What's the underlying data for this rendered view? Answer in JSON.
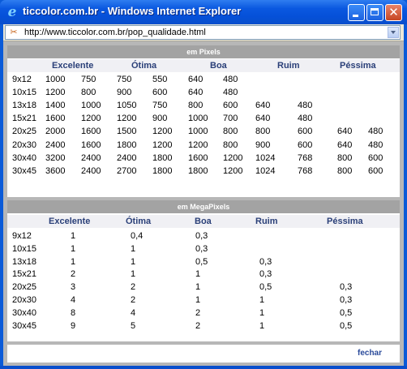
{
  "window": {
    "title": "ticcolor.com.br - Windows Internet Explorer",
    "url": "http://www.ticcolor.com.br/pop_qualidade.html"
  },
  "colors": {
    "titlebar": "#0a58e0",
    "section_bar": "#a3a3a3",
    "header_text": "#2a3f78",
    "link": "#2a4a9a"
  },
  "pixels": {
    "title": "em Pixels",
    "headers": [
      "Excelente",
      "Ótima",
      "Boa",
      "Ruim",
      "Péssima"
    ],
    "rows": [
      [
        "9x12",
        "1000",
        "750",
        "750",
        "550",
        "640",
        "480",
        "",
        "",
        "",
        ""
      ],
      [
        "10x15",
        "1200",
        "800",
        "900",
        "600",
        "640",
        "480",
        "",
        "",
        "",
        ""
      ],
      [
        "13x18",
        "1400",
        "1000",
        "1050",
        "750",
        "800",
        "600",
        "640",
        "480",
        "",
        ""
      ],
      [
        "15x21",
        "1600",
        "1200",
        "1200",
        "900",
        "1000",
        "700",
        "640",
        "480",
        "",
        ""
      ],
      [
        "20x25",
        "2000",
        "1600",
        "1500",
        "1200",
        "1000",
        "800",
        "800",
        "600",
        "640",
        "480"
      ],
      [
        "20x30",
        "2400",
        "1600",
        "1800",
        "1200",
        "1200",
        "800",
        "900",
        "600",
        "640",
        "480"
      ],
      [
        "30x40",
        "3200",
        "2400",
        "2400",
        "1800",
        "1600",
        "1200",
        "1024",
        "768",
        "800",
        "600"
      ],
      [
        "30x45",
        "3600",
        "2400",
        "2700",
        "1800",
        "1800",
        "1200",
        "1024",
        "768",
        "800",
        "600"
      ]
    ]
  },
  "megapixels": {
    "title": "em MegaPixels",
    "headers": [
      "Excelente",
      "Ótima",
      "Boa",
      "Ruim",
      "Péssima"
    ],
    "rows": [
      [
        "9x12",
        "1",
        "0,4",
        "0,3",
        "",
        ""
      ],
      [
        "10x15",
        "1",
        "1",
        "0,3",
        "",
        ""
      ],
      [
        "13x18",
        "1",
        "1",
        "0,5",
        "0,3",
        ""
      ],
      [
        "15x21",
        "2",
        "1",
        "1",
        "0,3",
        ""
      ],
      [
        "20x25",
        "3",
        "2",
        "1",
        "0,5",
        "0,3"
      ],
      [
        "20x30",
        "4",
        "2",
        "1",
        "1",
        "0,3"
      ],
      [
        "30x40",
        "8",
        "4",
        "2",
        "1",
        "0,5"
      ],
      [
        "30x45",
        "9",
        "5",
        "2",
        "1",
        "0,5"
      ]
    ]
  },
  "footer": {
    "close_label": "fechar"
  }
}
